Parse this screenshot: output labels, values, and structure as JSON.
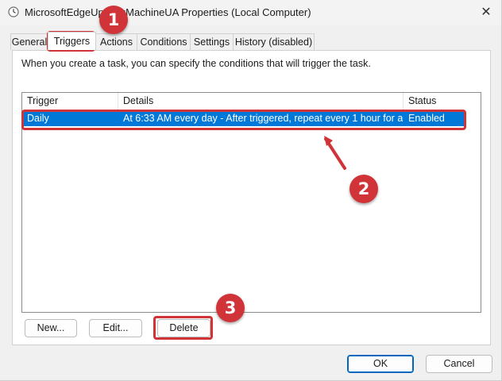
{
  "window": {
    "title": "MicrosoftEdgeUpdaskMachineUA Properties (Local Computer)",
    "close_glyph": "✕"
  },
  "tabs": [
    {
      "label": "General"
    },
    {
      "label": "Triggers",
      "active": true
    },
    {
      "label": "Actions"
    },
    {
      "label": "Conditions"
    },
    {
      "label": "Settings"
    },
    {
      "label": "History (disabled)"
    }
  ],
  "triggers": {
    "intro": "When you create a task, you can specify the conditions that will trigger the task.",
    "columns": {
      "trigger": "Trigger",
      "details": "Details",
      "status": "Status"
    },
    "rows": [
      {
        "trigger": "Daily",
        "details": "At 6:33 AM every day - After triggered, repeat every 1 hour for a ...",
        "status": "Enabled",
        "selected": true
      }
    ],
    "buttons": {
      "new": "New...",
      "edit": "Edit...",
      "delete": "Delete"
    }
  },
  "footer": {
    "ok": "OK",
    "cancel": "Cancel"
  },
  "annotations": {
    "badge1": "1",
    "badge2": "2",
    "badge3": "3",
    "highlight_color": "#d13438"
  },
  "colors": {
    "selection": "#0078d7",
    "accent": "#0067c0"
  }
}
